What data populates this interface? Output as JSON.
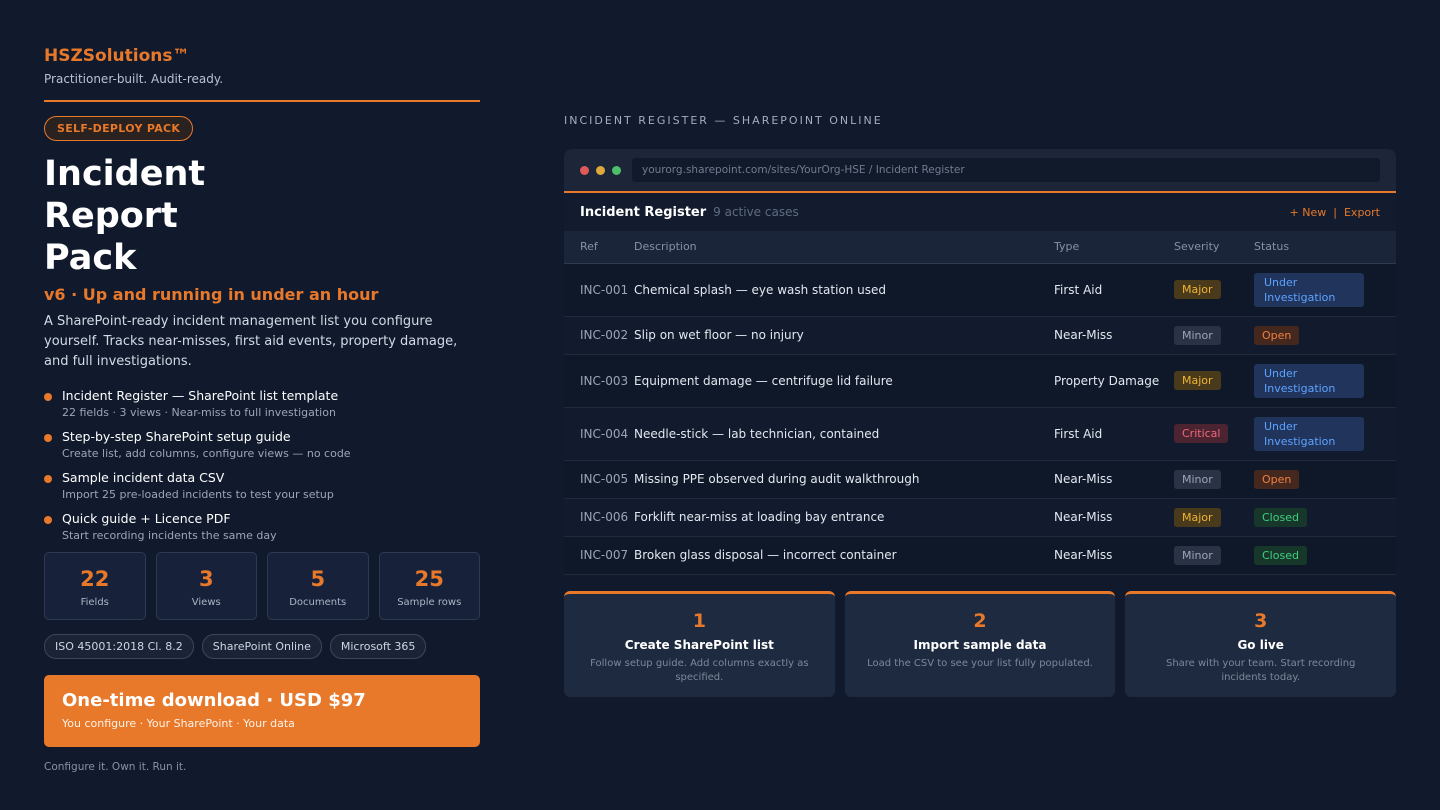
{
  "brand": {
    "name": "HSZSolutions™",
    "tagline": "Practitioner-built. Audit-ready."
  },
  "badge": "SELF-DEPLOY PACK",
  "title": "Incident Report Pack",
  "version_line": "v6  ·  Up and running in under an hour",
  "description": "A SharePoint-ready incident management list you configure yourself. Tracks near-misses, first aid events, property damage, and full investigations.",
  "features": [
    {
      "title": "Incident Register — SharePoint list template",
      "sub": "22 fields · 3 views · Near-miss to full investigation"
    },
    {
      "title": "Step-by-step SharePoint setup guide",
      "sub": "Create list, add columns, configure views — no code"
    },
    {
      "title": "Sample incident data CSV",
      "sub": "Import 25 pre-loaded incidents to test your setup"
    },
    {
      "title": "Quick guide + Licence PDF",
      "sub": "Start recording incidents the same day"
    }
  ],
  "stats": [
    {
      "value": "22",
      "label": "Fields"
    },
    {
      "value": "3",
      "label": "Views"
    },
    {
      "value": "5",
      "label": "Documents"
    },
    {
      "value": "25",
      "label": "Sample rows"
    }
  ],
  "chips": [
    "ISO 45001:2018 Cl. 8.2",
    "SharePoint Online",
    "Microsoft 365"
  ],
  "cta": {
    "main": "One-time download  ·  USD $97",
    "sub": "You configure · Your SharePoint · Your data"
  },
  "footer_note": "Configure it. Own it. Run it.",
  "preview": {
    "section_label": "INCIDENT REGISTER — SHAREPOINT ONLINE",
    "url": "yourorg.sharepoint.com/sites/YourOrg-HSE  /  Incident Register",
    "window_dot_colors": [
      "#e05a5a",
      "#e0a83a",
      "#4bbf6a"
    ],
    "list_title": "Incident Register",
    "list_count": "9 active cases",
    "new_label": "+ New",
    "action_separator": "|",
    "export_label": "Export",
    "columns": [
      "Ref",
      "Description",
      "Type",
      "Severity",
      "Status"
    ],
    "rows": [
      {
        "ref": "INC-001",
        "description": "Chemical splash — eye wash station used",
        "type": "First Aid",
        "severity": "Major",
        "status": "Under Investigation"
      },
      {
        "ref": "INC-002",
        "description": "Slip on wet floor — no injury",
        "type": "Near-Miss",
        "severity": "Minor",
        "status": "Open"
      },
      {
        "ref": "INC-003",
        "description": "Equipment damage — centrifuge lid failure",
        "type": "Property Damage",
        "severity": "Major",
        "status": "Under Investigation"
      },
      {
        "ref": "INC-004",
        "description": "Needle-stick — lab technician, contained",
        "type": "First Aid",
        "severity": "Critical",
        "status": "Under Investigation"
      },
      {
        "ref": "INC-005",
        "description": "Missing PPE observed during audit walkthrough",
        "type": "Near-Miss",
        "severity": "Minor",
        "status": "Open"
      },
      {
        "ref": "INC-006",
        "description": "Forklift near-miss at loading bay entrance",
        "type": "Near-Miss",
        "severity": "Major",
        "status": "Closed"
      },
      {
        "ref": "INC-007",
        "description": "Broken glass disposal — incorrect container",
        "type": "Near-Miss",
        "severity": "Minor",
        "status": "Closed"
      }
    ]
  },
  "steps": [
    {
      "num": "1",
      "title": "Create SharePoint list",
      "desc": "Follow setup guide. Add columns exactly as specified."
    },
    {
      "num": "2",
      "title": "Import sample data",
      "desc": "Load the CSV to see your list fully populated."
    },
    {
      "num": "3",
      "title": "Go live",
      "desc": "Share with your team. Start recording incidents today."
    }
  ],
  "colors": {
    "accent": "#e8782a",
    "background": "#111a2c"
  }
}
